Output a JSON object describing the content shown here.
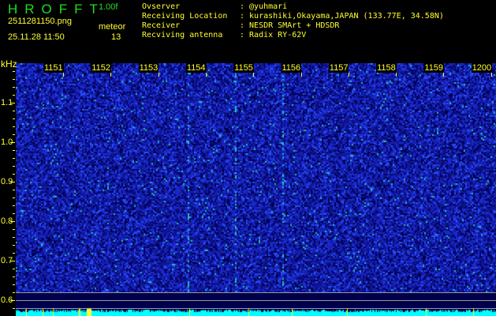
{
  "app": {
    "title": "HROFFT",
    "version": "1.00f"
  },
  "file": {
    "name": "2511281150.png",
    "datetime": "25.11.28 11:50"
  },
  "meteor": {
    "label": "meteor",
    "count": "13"
  },
  "info": [
    {
      "key": "Ovserver",
      "value": ": @yuhmari"
    },
    {
      "key": "Receiving Location",
      "value": ": kurashiki,Okayama,JAPAN (133.77E, 34.58N)"
    },
    {
      "key": "Receiver",
      "value": ": NESDR SMArt + HDSDR"
    },
    {
      "key": "Recviving antenna",
      "value": ": Radix RY-62V"
    }
  ],
  "axis": {
    "y_unit": "kHz",
    "y_labels": [
      "1.1",
      "1.0",
      "0.9",
      "0.8",
      "0.7",
      "0.6"
    ],
    "time_labels": [
      "1151",
      "1152",
      "1153",
      "1154",
      "1155",
      "1156",
      "1157",
      "1158",
      "1159",
      "1200"
    ]
  },
  "colors": {
    "text": "#ffff30",
    "title": "#22dd22",
    "signal": "#00ffff",
    "background": "#000060"
  }
}
